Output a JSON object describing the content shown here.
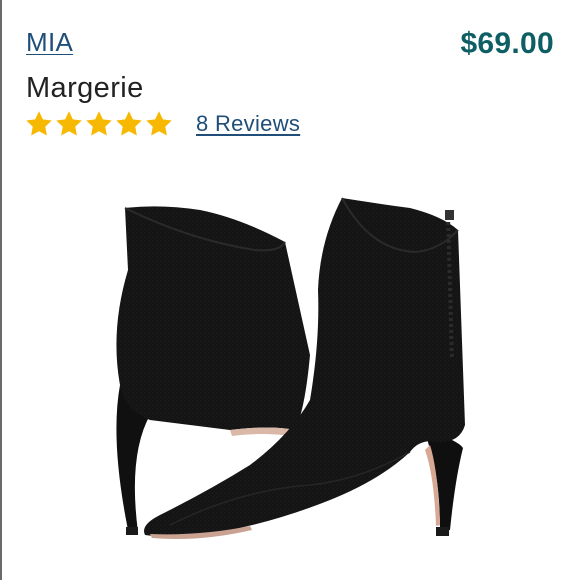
{
  "product": {
    "brand": "MIA",
    "name": "Margerie",
    "price": "$69.00",
    "rating": 5,
    "rating_max": 5,
    "reviews_label": "8 Reviews"
  },
  "colors": {
    "link": "#1f4e79",
    "price": "#0e5f63",
    "star": "#f6b800",
    "text": "#222222"
  },
  "icons": {
    "star": "star-icon",
    "product_image": "black-knit-ankle-boots"
  }
}
